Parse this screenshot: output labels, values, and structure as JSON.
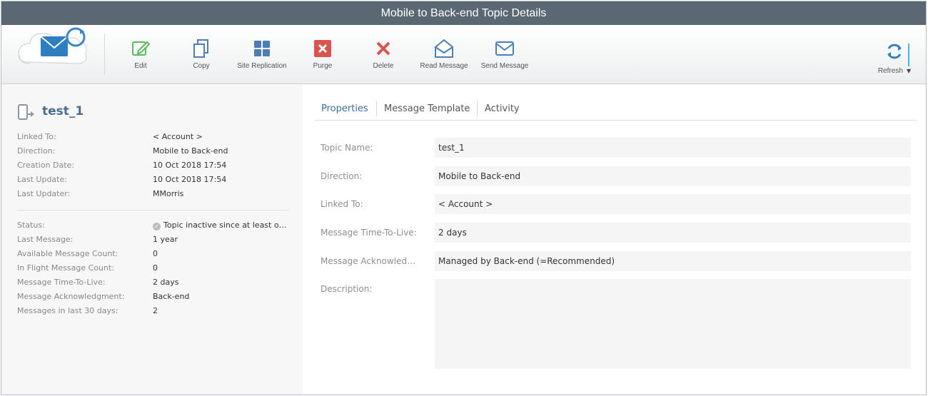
{
  "window": {
    "title": "Mobile to Back-end Topic Details"
  },
  "toolbar": {
    "buttons": [
      {
        "label": "Edit",
        "icon": "edit-icon",
        "color": "#5cb85c"
      },
      {
        "label": "Copy",
        "icon": "copy-icon",
        "color": "#4a7eb5"
      },
      {
        "label": "Site Replication",
        "icon": "grid-icon",
        "color": "#4a7eb5"
      },
      {
        "label": "Purge",
        "icon": "purge-icon",
        "color": "#d9534f"
      },
      {
        "label": "Delete",
        "icon": "delete-icon",
        "color": "#d9534f"
      },
      {
        "label": "Read Message",
        "icon": "envelope-open-icon",
        "color": "#4a7eb5"
      },
      {
        "label": "Send Message",
        "icon": "envelope-icon",
        "color": "#4a7eb5"
      }
    ],
    "refresh_label": "Refresh"
  },
  "topic": {
    "name": "test_1",
    "details": [
      {
        "key": "Linked To:",
        "value": "< Account >"
      },
      {
        "key": "Direction:",
        "value": "Mobile to Back-end"
      },
      {
        "key": "Creation Date:",
        "value": "10 Oct 2018 17:54"
      },
      {
        "key": "Last Update:",
        "value": "10 Oct 2018 17:54"
      },
      {
        "key": "Last Updater:",
        "value": "MMorris"
      }
    ],
    "stats": [
      {
        "key": "Status:",
        "value": "Topic inactive since at least one year"
      },
      {
        "key": "Last Message:",
        "value": "1 year"
      },
      {
        "key": "Available Message Count:",
        "value": "0"
      },
      {
        "key": "In Flight Message Count:",
        "value": "0"
      },
      {
        "key": "Message Time-To-Live:",
        "value": "2 days"
      },
      {
        "key": "Message Acknowledgment:",
        "value": "Back-end"
      },
      {
        "key": "Messages in last 30 days:",
        "value": "2"
      }
    ]
  },
  "tabs": [
    {
      "label": "Properties",
      "active": true
    },
    {
      "label": "Message Template",
      "active": false
    },
    {
      "label": "Activity",
      "active": false
    }
  ],
  "form": {
    "fields": [
      {
        "label": "Topic Name:",
        "value": "test_1"
      },
      {
        "label": "Direction:",
        "value": "Mobile to Back-end"
      },
      {
        "label": "Linked To:",
        "value": "< Account >"
      },
      {
        "label": "Message Time-To-Live:",
        "value": "2 days"
      },
      {
        "label": "Message Acknowledgment:",
        "value": "Managed by Back-end (=Recommended)"
      }
    ],
    "description_label": "Description:",
    "description_value": ""
  },
  "colors": {
    "titlebar": "#5b6873",
    "accent": "#3a6f9f",
    "danger": "#d9534f",
    "success": "#5cb85c"
  }
}
